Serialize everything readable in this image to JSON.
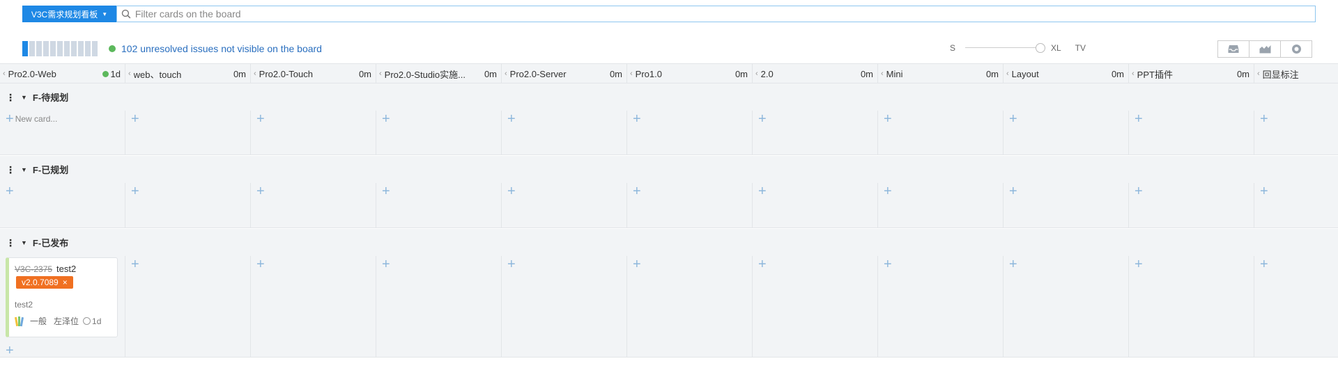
{
  "toolbar": {
    "board_name": "V3C需求规划看板",
    "filter_placeholder": "Filter cards on the board",
    "unresolved_text": "102 unresolved issues not visible on the board",
    "size_small": "S",
    "size_xl": "XL",
    "size_tv": "TV",
    "view_icons": [
      "inbox-icon",
      "chart-icon",
      "settings-icon"
    ]
  },
  "columns": [
    {
      "name": "Pro2.0-Web",
      "time": "1d",
      "has_dot": true
    },
    {
      "name": "web、touch",
      "time": "0m"
    },
    {
      "name": "Pro2.0-Touch",
      "time": "0m"
    },
    {
      "name": "Pro2.0-Studio实施...",
      "time": "0m"
    },
    {
      "name": "Pro2.0-Server",
      "time": "0m"
    },
    {
      "name": "Pro1.0",
      "time": "0m"
    },
    {
      "name": "2.0",
      "time": "0m"
    },
    {
      "name": "Mini",
      "time": "0m"
    },
    {
      "name": "Layout",
      "time": "0m"
    },
    {
      "name": "PPT插件",
      "time": "0m"
    },
    {
      "name": "回显标注",
      "time": ""
    }
  ],
  "lanes": [
    {
      "title": "F-待规划",
      "new_card_label": "New card..."
    },
    {
      "title": "F-已规划"
    },
    {
      "title": "F-已发布"
    }
  ],
  "card": {
    "key": "V3C-2375",
    "title": "test2",
    "version": "v2.0.7089",
    "description": "test2",
    "priority": "一般",
    "assignee": "左泽位",
    "age": "1d",
    "accent_color": "#c8e6a8",
    "version_color": "#f07021"
  },
  "colors": {
    "primary": "#1e88e5",
    "status_green": "#5cb85c",
    "lane_bg": "#f2f4f6"
  }
}
